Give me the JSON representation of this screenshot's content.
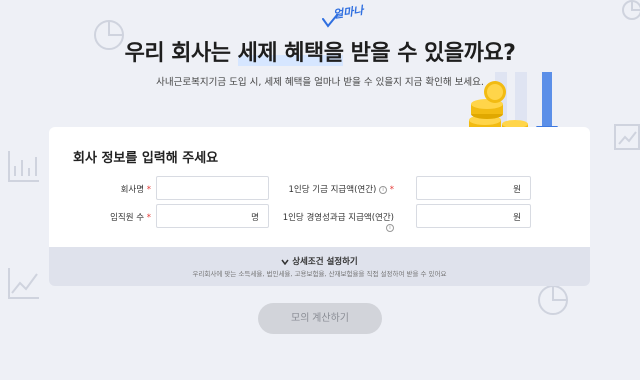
{
  "header": {
    "title_part1": "우리 회사는 ",
    "title_highlight": "세제 혜택을",
    "title_part2": " 받을 수 있을까요?",
    "handwritten_note": "얼마나",
    "subtitle": "사내근로복지기금 도입 시, 세제 혜택을 얼마나 받을 수 있을지 지금 확인해 보세요."
  },
  "form": {
    "title": "회사 정보를 입력해 주세요",
    "fields": {
      "company_name": {
        "label": "회사명",
        "required_mark": "*",
        "value": ""
      },
      "employee_count": {
        "label": "임직원 수",
        "required_mark": "*",
        "unit": "명",
        "value": ""
      },
      "fund_contribution": {
        "label": "1인당 기금 지급액(연간)",
        "info": "i",
        "required_mark": "*",
        "unit": "원",
        "value": ""
      },
      "bonus_payment": {
        "label": "1인당 경영성과급 지급액(연간)",
        "info": "i",
        "unit": "원",
        "value": ""
      }
    }
  },
  "detail": {
    "toggle_label": "상세조건 설정하기",
    "toggle_icon": "chevron-down-icon",
    "description": "우리회사에 맞는 소득세율, 법인세율, 고용보험율, 산재보험율을 직접 설정하여 받을 수 있어요"
  },
  "actions": {
    "calculate_label": "모의 계산하기"
  },
  "colors": {
    "background": "#eef0f6",
    "accent_blue": "#2f6fe0",
    "required_red": "#e53935",
    "button_disabled": "#d2d4da"
  }
}
